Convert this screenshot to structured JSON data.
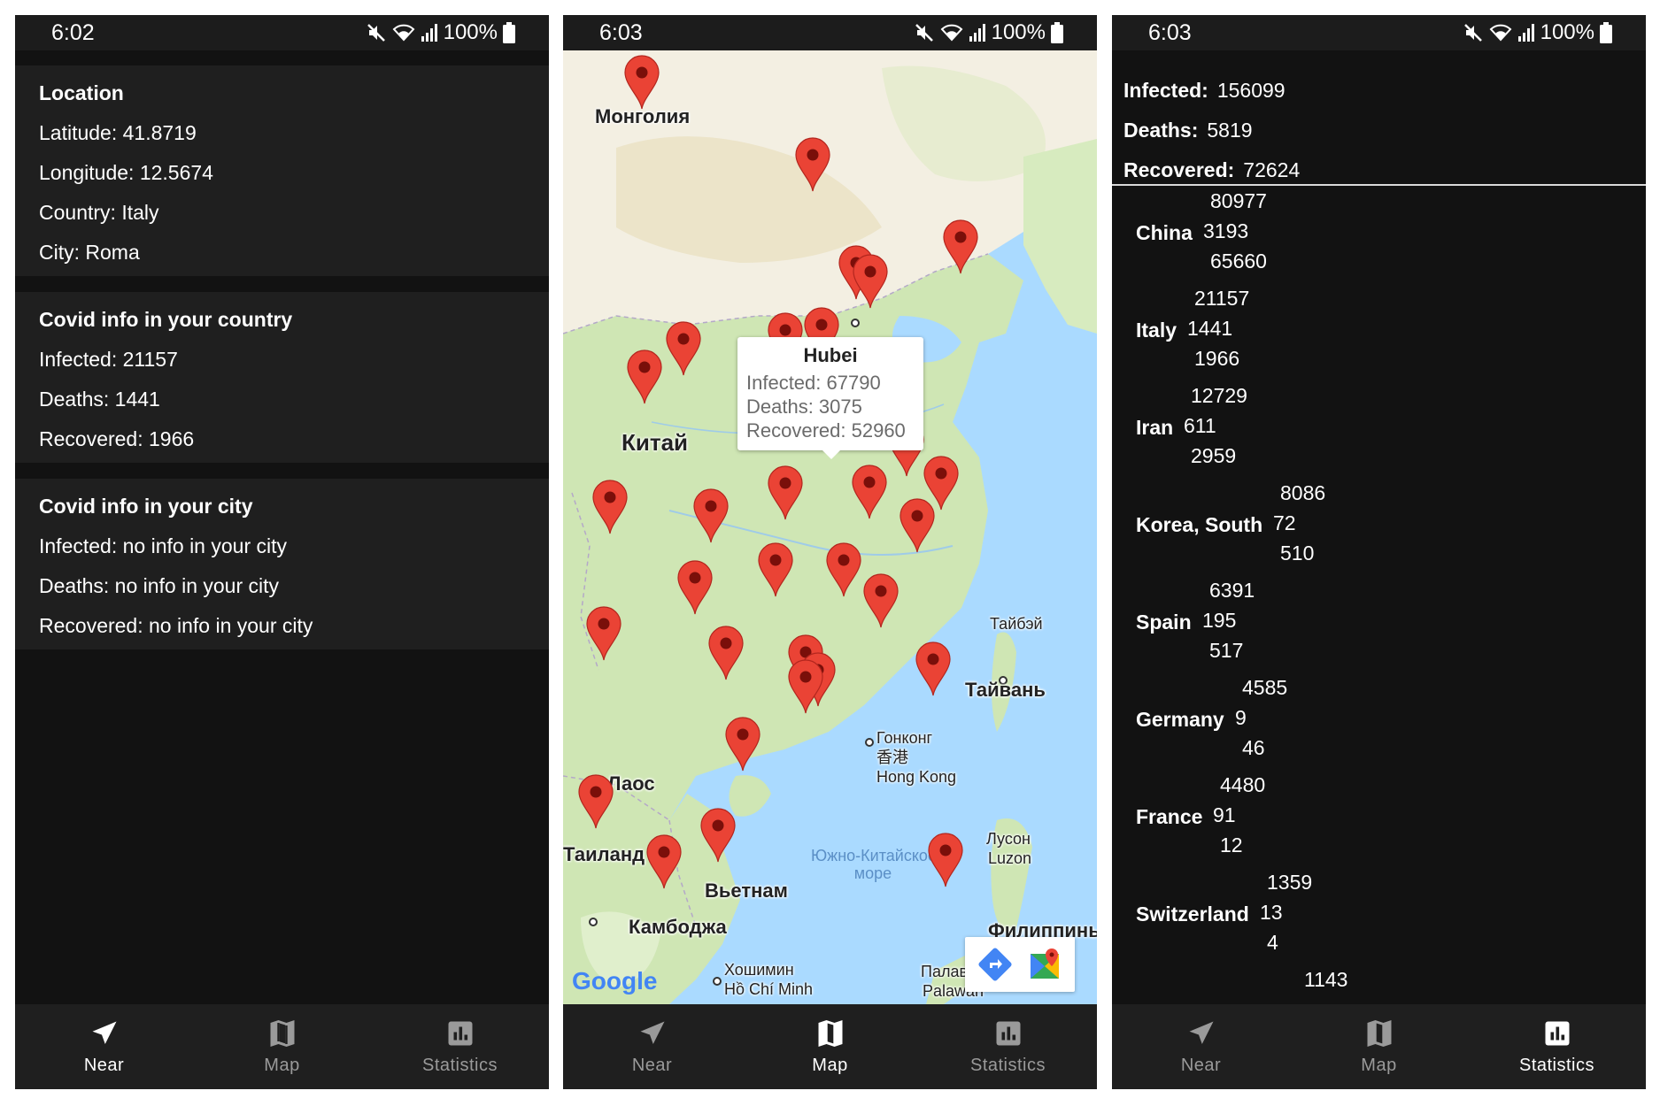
{
  "status_bars": [
    {
      "time": "6:02",
      "battery": "100%"
    },
    {
      "time": "6:03",
      "battery": "100%"
    },
    {
      "time": "6:03",
      "battery": "100%"
    }
  ],
  "nav": {
    "items": [
      {
        "label": "Near",
        "icon": "navigation-arrow-icon"
      },
      {
        "label": "Map",
        "icon": "map-icon"
      },
      {
        "label": "Statistics",
        "icon": "bar-chart-icon"
      }
    ]
  },
  "near": {
    "location": {
      "title": "Location",
      "latitude": "Latitude: 41.8719",
      "longitude": "Longitude: 12.5674",
      "country": "Country: Italy",
      "city": "City: Roma"
    },
    "country_info": {
      "title": "Covid info in your country",
      "infected": "Infected: 21157",
      "deaths": "Deaths: 1441",
      "recovered": "Recovered: 1966"
    },
    "city_info": {
      "title": "Covid info in your city",
      "infected": "Infected: no info in your city",
      "deaths": "Deaths: no info in your city",
      "recovered": "Recovered: no info in your city"
    }
  },
  "map": {
    "labels": {
      "mongolia": "Монголия",
      "china": "Китай",
      "laos": "Лаос",
      "thailand": "Таиланд",
      "vietnam": "Вьетнам",
      "cambodia": "Камбоджа",
      "taipei": "Тайбэй",
      "taiwan": "Тайвань",
      "hongkong_ru": "Гонконг",
      "hongkong_zh": "香港",
      "hongkong_en": "Hong Kong",
      "sea_line1": "Южно-Китайское",
      "sea_line2": "море",
      "luzon_ru": "Лусон",
      "luzon_en": "Luzon",
      "philippines": "Филиппины",
      "hochiminh_ru": "Хошимин",
      "hochiminh_en": "Hồ Chí Minh",
      "palawan_ru": "Палаван",
      "palawan_en": "Palawan",
      "google": "Google"
    },
    "info_window": {
      "title": "Hubei",
      "infected": "Infected: 67790",
      "deaths": "Deaths: 3075",
      "recovered": "Recovered: 52960"
    },
    "colors": {
      "pin": "#ea4335",
      "pin_dot": "#7a0f0a",
      "land": "#cfe6b4",
      "water": "#aadaff"
    }
  },
  "stats": {
    "summary": [
      {
        "label": "Infected:",
        "value": "156099"
      },
      {
        "label": "Deaths:",
        "value": "5819"
      },
      {
        "label": "Recovered:",
        "value": "72624"
      }
    ],
    "countries": [
      {
        "name": "China",
        "infected": "80977",
        "deaths": "3193",
        "recovered": "65660"
      },
      {
        "name": "Italy",
        "infected": "21157",
        "deaths": "1441",
        "recovered": "1966"
      },
      {
        "name": "Iran",
        "infected": "12729",
        "deaths": "611",
        "recovered": "2959"
      },
      {
        "name": "Korea, South",
        "infected": "8086",
        "deaths": "72",
        "recovered": "510"
      },
      {
        "name": "Spain",
        "infected": "6391",
        "deaths": "195",
        "recovered": "517"
      },
      {
        "name": "Germany",
        "infected": "4585",
        "deaths": "9",
        "recovered": "46"
      },
      {
        "name": "France",
        "infected": "4480",
        "deaths": "91",
        "recovered": "12"
      },
      {
        "name": "Switzerland",
        "infected": "1359",
        "deaths": "13",
        "recovered": "4"
      },
      {
        "name": "",
        "infected": "1143",
        "deaths": "",
        "recovered": ""
      }
    ]
  }
}
